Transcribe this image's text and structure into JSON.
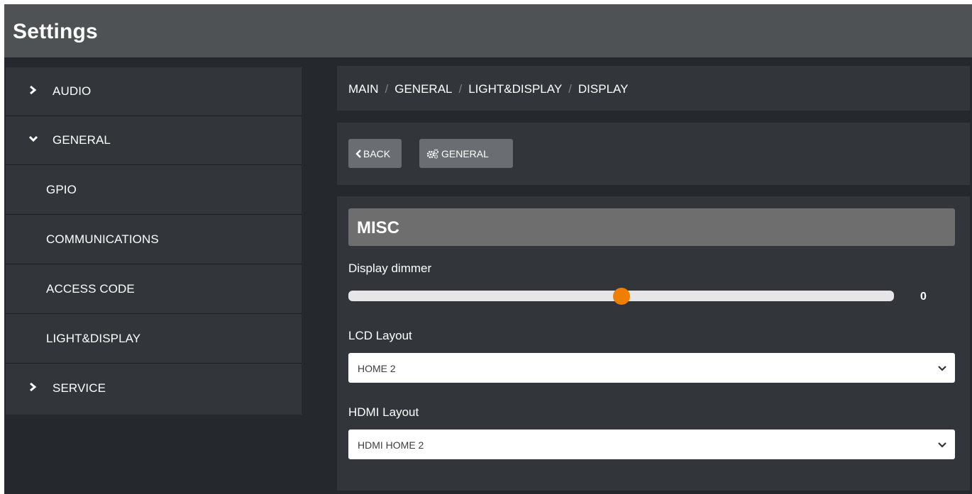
{
  "app": {
    "title": "Settings"
  },
  "sidebar": {
    "items": [
      {
        "label": "AUDIO",
        "expanded": false,
        "icon": "chevron-right-icon"
      },
      {
        "label": "GENERAL",
        "expanded": true,
        "icon": "chevron-down-icon"
      },
      {
        "label": "GPIO"
      },
      {
        "label": "COMMUNICATIONS"
      },
      {
        "label": "ACCESS CODE"
      },
      {
        "label": "LIGHT&DISPLAY"
      },
      {
        "label": "SERVICE",
        "expanded": false,
        "icon": "chevron-right-icon"
      }
    ]
  },
  "breadcrumb": {
    "items": [
      "MAIN",
      "GENERAL",
      "LIGHT&DISPLAY",
      "DISPLAY"
    ],
    "separator": "/"
  },
  "toolbar": {
    "back_label": "BACK",
    "back_icon": "chevron-left-icon",
    "general_label": "GENERAL",
    "general_icon": "gears-icon"
  },
  "section": {
    "title": "MISC",
    "display_dimmer": {
      "label": "Display dimmer",
      "value": "0",
      "level": 0.5
    },
    "lcd_layout": {
      "label": "LCD Layout",
      "selected": "HOME 2"
    },
    "hdmi_layout": {
      "label": "HDMI Layout",
      "selected": "HDMI HOME 2"
    }
  },
  "colors": {
    "accent": "#f07f00",
    "background": "#25282c",
    "panel": "#32353a",
    "titlebar": "#4f5255",
    "button": "#6a6d71"
  }
}
